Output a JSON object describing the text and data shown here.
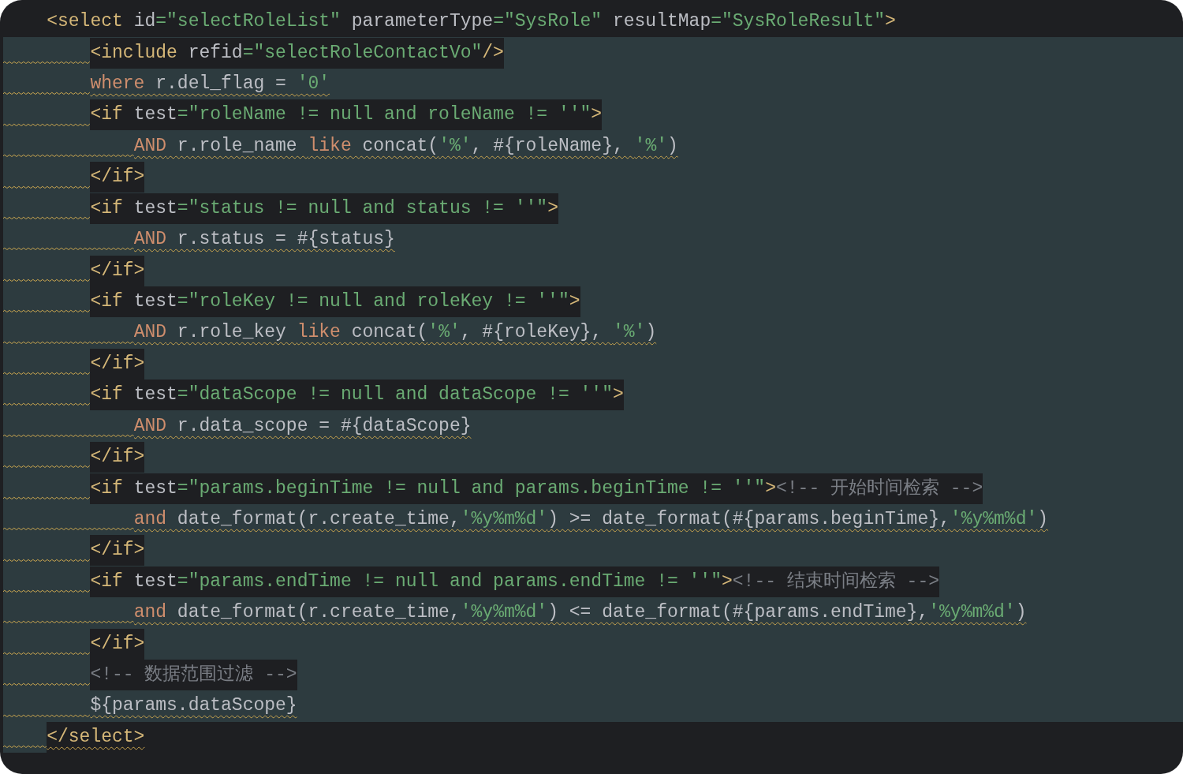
{
  "editor": {
    "lines": [
      {
        "injected": false,
        "warning": false,
        "highlighted": true,
        "segments": [
          {
            "kind": "tag",
            "text": "<select"
          },
          {
            "kind": "attr",
            "text": " id"
          },
          {
            "kind": "string",
            "text": "=\"selectRoleList\""
          },
          {
            "kind": "attr",
            "text": " parameterType"
          },
          {
            "kind": "string",
            "text": "=\"SysRole\""
          },
          {
            "kind": "attr",
            "text": " resultMap"
          },
          {
            "kind": "string",
            "text": "=\"SysRoleResult\""
          },
          {
            "kind": "tag",
            "text": ">"
          }
        ],
        "children": [
          {
            "injected": true,
            "warning": true,
            "highlighted": true,
            "segments": [
              {
                "kind": "tag",
                "text": "<include"
              },
              {
                "kind": "attr",
                "text": " refid"
              },
              {
                "kind": "string",
                "text": "=\"selectRoleContactVo\""
              },
              {
                "kind": "tag",
                "text": "/>"
              }
            ]
          },
          {
            "injected": true,
            "warning": true,
            "highlighted": false,
            "segments": [
              {
                "kind": "keyword",
                "text": "where"
              },
              {
                "kind": "plain",
                "text": " r.del_flag = "
              },
              {
                "kind": "string",
                "text": "'0'"
              }
            ]
          },
          {
            "injected": true,
            "warning": true,
            "highlighted": true,
            "segments": [
              {
                "kind": "tag",
                "text": "<if"
              },
              {
                "kind": "attr",
                "text": " test"
              },
              {
                "kind": "string",
                "text": "=\"roleName != null and roleName != ''\""
              },
              {
                "kind": "tag",
                "text": ">"
              }
            ],
            "children": [
              {
                "injected": true,
                "warning": true,
                "highlighted": false,
                "segments": [
                  {
                    "kind": "keyword",
                    "text": "AND"
                  },
                  {
                    "kind": "plain",
                    "text": " r.role_name "
                  },
                  {
                    "kind": "keyword",
                    "text": "like"
                  },
                  {
                    "kind": "plain",
                    "text": " concat("
                  },
                  {
                    "kind": "string",
                    "text": "'%'"
                  },
                  {
                    "kind": "plain",
                    "text": ", #{roleName}, "
                  },
                  {
                    "kind": "string",
                    "text": "'%'"
                  },
                  {
                    "kind": "plain",
                    "text": ")"
                  }
                ]
              }
            ]
          },
          {
            "injected": true,
            "warning": true,
            "highlighted": true,
            "segments": [
              {
                "kind": "tag",
                "text": "</if>"
              }
            ]
          },
          {
            "injected": true,
            "warning": true,
            "highlighted": true,
            "segments": [
              {
                "kind": "tag",
                "text": "<if"
              },
              {
                "kind": "attr",
                "text": " test"
              },
              {
                "kind": "string",
                "text": "=\"status != null and status != ''\""
              },
              {
                "kind": "tag",
                "text": ">"
              }
            ],
            "children": [
              {
                "injected": true,
                "warning": true,
                "highlighted": false,
                "segments": [
                  {
                    "kind": "keyword",
                    "text": "AND"
                  },
                  {
                    "kind": "plain",
                    "text": " r.status = #{status}"
                  }
                ]
              }
            ]
          },
          {
            "injected": true,
            "warning": true,
            "highlighted": true,
            "segments": [
              {
                "kind": "tag",
                "text": "</if>"
              }
            ]
          },
          {
            "injected": true,
            "warning": true,
            "highlighted": true,
            "segments": [
              {
                "kind": "tag",
                "text": "<if"
              },
              {
                "kind": "attr",
                "text": " test"
              },
              {
                "kind": "string",
                "text": "=\"roleKey != null and roleKey != ''\""
              },
              {
                "kind": "tag",
                "text": ">"
              }
            ],
            "children": [
              {
                "injected": true,
                "warning": true,
                "highlighted": false,
                "segments": [
                  {
                    "kind": "keyword",
                    "text": "AND"
                  },
                  {
                    "kind": "plain",
                    "text": " r.role_key "
                  },
                  {
                    "kind": "keyword",
                    "text": "like"
                  },
                  {
                    "kind": "plain",
                    "text": " concat("
                  },
                  {
                    "kind": "string",
                    "text": "'%'"
                  },
                  {
                    "kind": "plain",
                    "text": ", #{roleKey}, "
                  },
                  {
                    "kind": "string",
                    "text": "'%'"
                  },
                  {
                    "kind": "plain",
                    "text": ")"
                  }
                ]
              }
            ]
          },
          {
            "injected": true,
            "warning": true,
            "highlighted": true,
            "segments": [
              {
                "kind": "tag",
                "text": "</if>"
              }
            ]
          },
          {
            "injected": true,
            "warning": true,
            "highlighted": true,
            "segments": [
              {
                "kind": "tag",
                "text": "<if"
              },
              {
                "kind": "attr",
                "text": " test"
              },
              {
                "kind": "string",
                "text": "=\"dataScope != null and dataScope != ''\""
              },
              {
                "kind": "tag",
                "text": ">"
              }
            ],
            "children": [
              {
                "injected": true,
                "warning": true,
                "highlighted": false,
                "segments": [
                  {
                    "kind": "keyword",
                    "text": "AND"
                  },
                  {
                    "kind": "plain",
                    "text": " r.data_scope = #{dataScope}"
                  }
                ]
              }
            ]
          },
          {
            "injected": true,
            "warning": true,
            "highlighted": true,
            "segments": [
              {
                "kind": "tag",
                "text": "</if>"
              }
            ]
          },
          {
            "injected": true,
            "warning": true,
            "highlighted": true,
            "segments": [
              {
                "kind": "tag",
                "text": "<if"
              },
              {
                "kind": "attr",
                "text": " test"
              },
              {
                "kind": "string",
                "text": "=\"params.beginTime != null and params.beginTime != ''\""
              },
              {
                "kind": "tag",
                "text": ">"
              },
              {
                "kind": "comment",
                "text": "<!-- 开始时间检索 -->"
              }
            ],
            "children": [
              {
                "injected": true,
                "warning": true,
                "highlighted": false,
                "segments": [
                  {
                    "kind": "keyword",
                    "text": "and"
                  },
                  {
                    "kind": "plain",
                    "text": " date_format(r.create_time,"
                  },
                  {
                    "kind": "string",
                    "text": "'%y%m%d'"
                  },
                  {
                    "kind": "plain",
                    "text": ") >= date_format(#{params.beginTime},"
                  },
                  {
                    "kind": "string",
                    "text": "'%y%m%d'"
                  },
                  {
                    "kind": "plain",
                    "text": ")"
                  }
                ]
              }
            ]
          },
          {
            "injected": true,
            "warning": true,
            "highlighted": true,
            "segments": [
              {
                "kind": "tag",
                "text": "</if>"
              }
            ]
          },
          {
            "injected": true,
            "warning": true,
            "highlighted": true,
            "segments": [
              {
                "kind": "tag",
                "text": "<if"
              },
              {
                "kind": "attr",
                "text": " test"
              },
              {
                "kind": "string",
                "text": "=\"params.endTime != null and params.endTime != ''\""
              },
              {
                "kind": "tag",
                "text": ">"
              },
              {
                "kind": "comment",
                "text": "<!-- 结束时间检索 -->"
              }
            ],
            "children": [
              {
                "injected": true,
                "warning": true,
                "highlighted": false,
                "segments": [
                  {
                    "kind": "keyword",
                    "text": "and"
                  },
                  {
                    "kind": "plain",
                    "text": " date_format(r.create_time,"
                  },
                  {
                    "kind": "string",
                    "text": "'%y%m%d'"
                  },
                  {
                    "kind": "plain",
                    "text": ") <= date_format(#{params.endTime},"
                  },
                  {
                    "kind": "string",
                    "text": "'%y%m%d'"
                  },
                  {
                    "kind": "plain",
                    "text": ")"
                  }
                ]
              }
            ]
          },
          {
            "injected": true,
            "warning": true,
            "highlighted": true,
            "segments": [
              {
                "kind": "tag",
                "text": "</if>"
              }
            ]
          },
          {
            "injected": true,
            "warning": true,
            "highlighted": true,
            "segments": [
              {
                "kind": "comment",
                "text": "<!-- 数据范围过滤 -->"
              }
            ]
          },
          {
            "injected": true,
            "warning": true,
            "highlighted": false,
            "segments": [
              {
                "kind": "plain",
                "text": "${params.dataScope}"
              }
            ]
          }
        ]
      },
      {
        "injected": false,
        "warning": true,
        "highlighted": false,
        "segments": [
          {
            "kind": "tag",
            "text": "</select>"
          }
        ]
      }
    ]
  }
}
